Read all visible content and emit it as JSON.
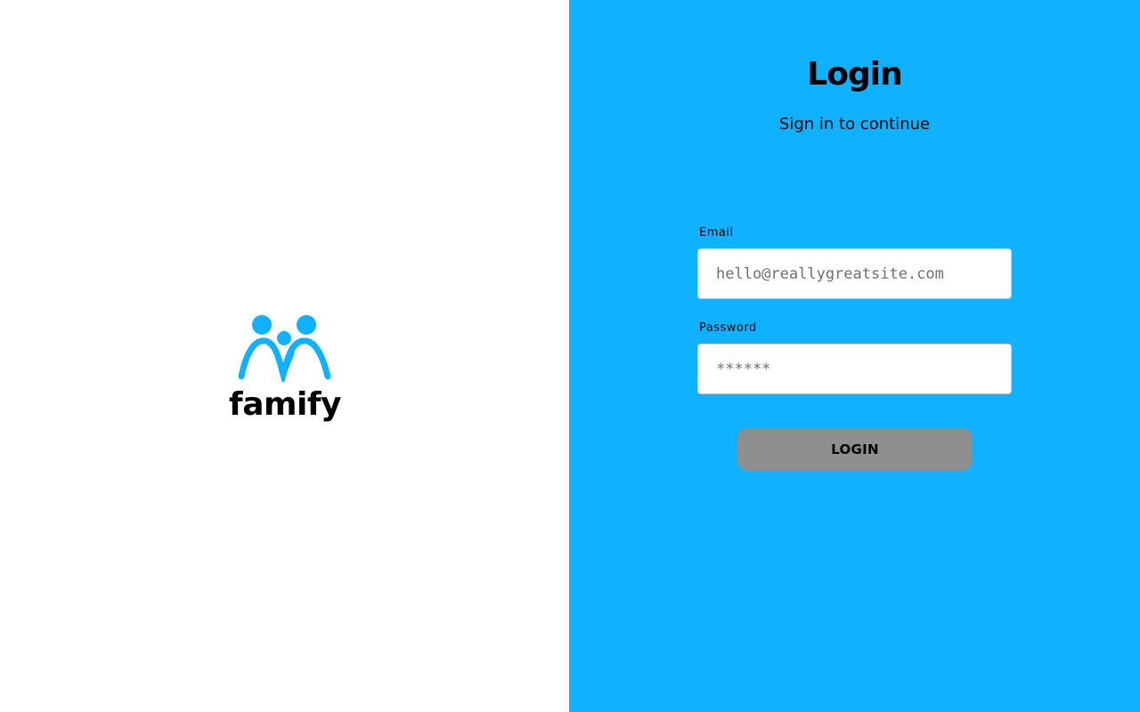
{
  "brand": {
    "name": "famify",
    "logo_icon": "family-figures-icon",
    "logo_color": "#10b2ff"
  },
  "login": {
    "title": "Login",
    "subtitle": "Sign in to continue",
    "email_label": "Email",
    "email_placeholder": "hello@reallygreatsite.com",
    "password_label": "Password",
    "password_placeholder": "******",
    "button_label": "LOGIN"
  },
  "colors": {
    "panel_background": "#10b2ff",
    "button_background": "#8f8f8f",
    "left_background": "#ffffff"
  }
}
